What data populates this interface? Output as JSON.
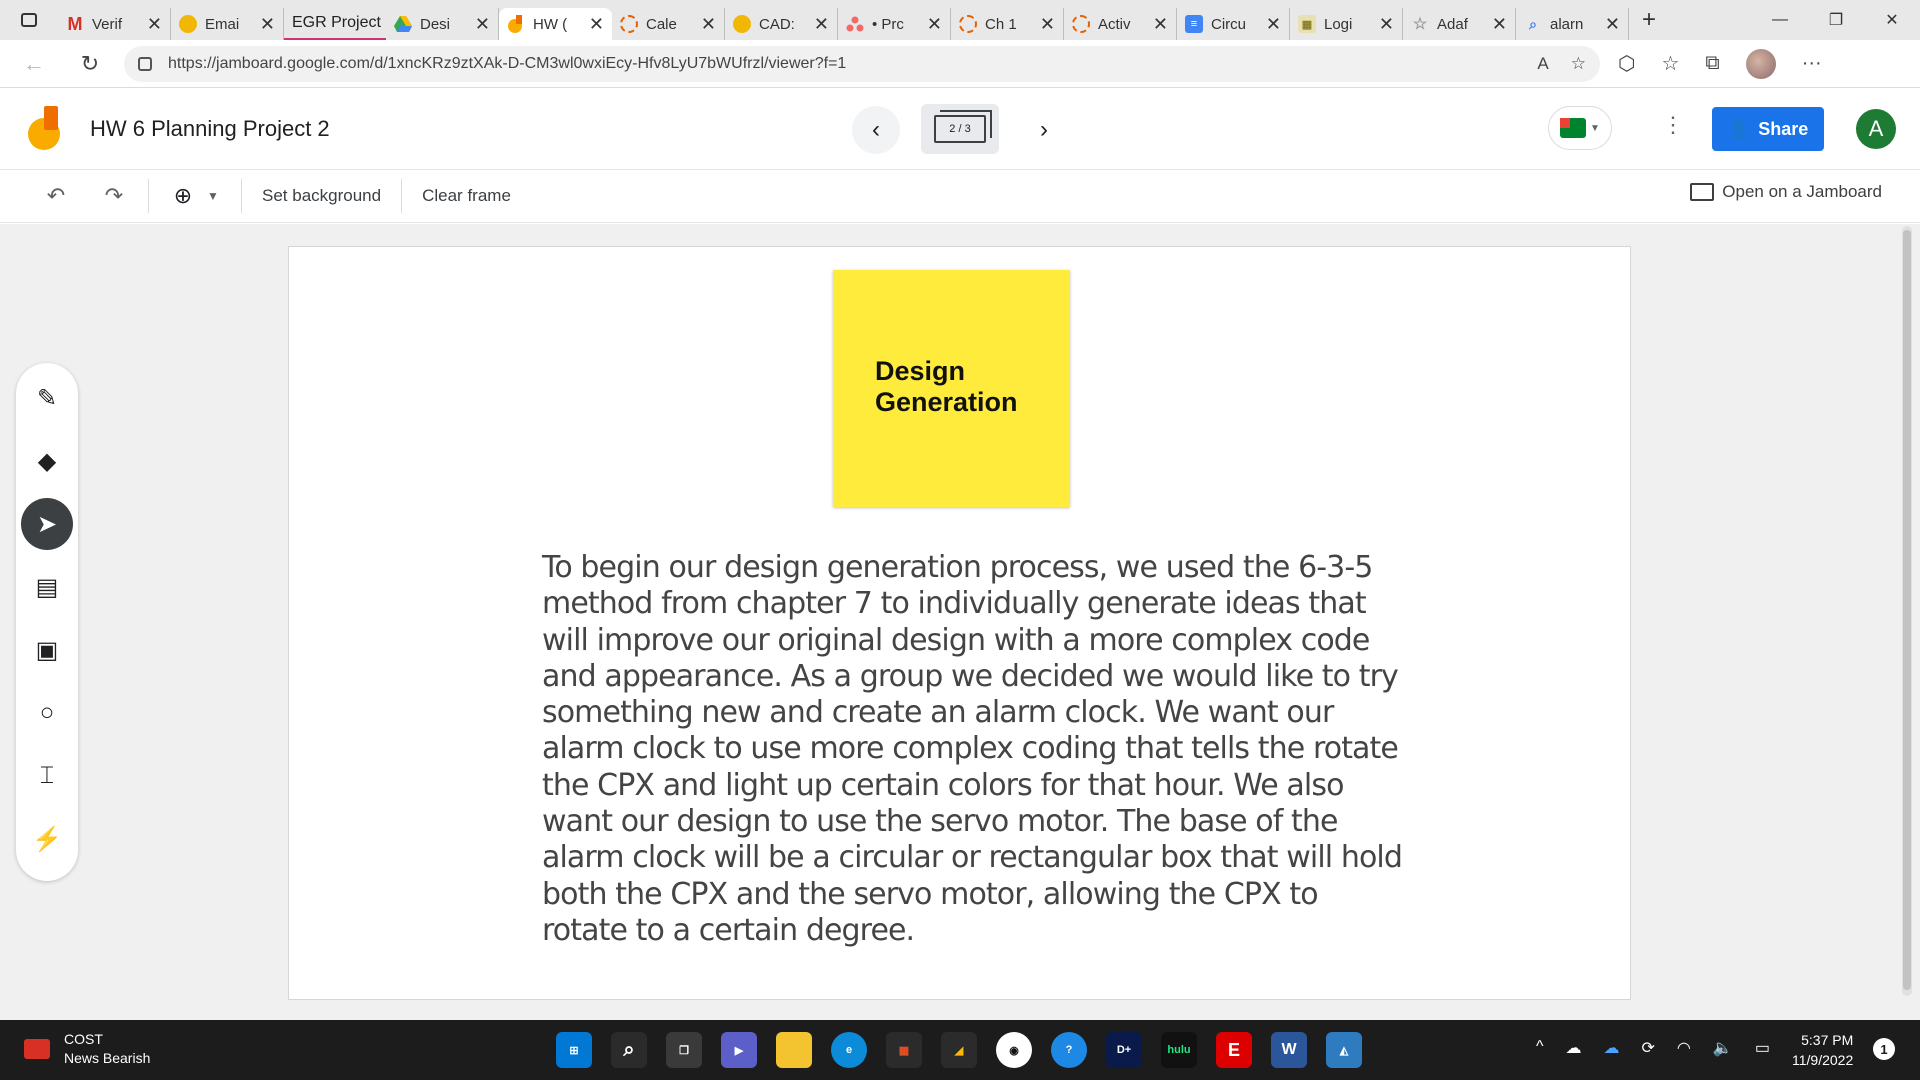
{
  "browser": {
    "tabs": [
      {
        "label": "Verif",
        "icon": "gmail-icon",
        "color": "#d93025",
        "glyph": "M"
      },
      {
        "label": "Emai",
        "icon": "avatar-icon",
        "color": "#f2b705",
        "glyph": ""
      },
      {
        "group": "EGR Project",
        "group_color": "#d0327a"
      },
      {
        "label": "Desi",
        "icon": "drive-icon",
        "color": "#34a853",
        "glyph": ""
      },
      {
        "label": "HW (",
        "icon": "jamboard-icon",
        "color": "#f9ab00",
        "glyph": "",
        "active": true
      },
      {
        "label": "Cale",
        "icon": "canvas-icon",
        "color": "#e66000",
        "glyph": ""
      },
      {
        "label": "CAD:",
        "icon": "avatar-icon",
        "color": "#f2b705",
        "glyph": ""
      },
      {
        "label": "• Prc",
        "icon": "asana-icon",
        "color": "#f06a6a",
        "glyph": ""
      },
      {
        "label": "Ch 1",
        "icon": "canvas-icon",
        "color": "#e66000",
        "glyph": ""
      },
      {
        "label": "Activ",
        "icon": "canvas-icon",
        "color": "#e66000",
        "glyph": ""
      },
      {
        "label": "Circu",
        "icon": "docs-icon",
        "color": "#4285f4",
        "glyph": ""
      },
      {
        "label": "Logi",
        "icon": "grid-icon",
        "color": "#c9b458",
        "glyph": ""
      },
      {
        "label": "Adaf",
        "icon": "star-icon",
        "color": "#9e9e9e",
        "glyph": ""
      },
      {
        "label": "alarn",
        "icon": "search-icon",
        "color": "#8ab4f8",
        "glyph": ""
      }
    ],
    "new_tab": "+",
    "url": "https://jamboard.google.com/d/1xncKRz9ztXAk-D-CM3wl0wxiEcy-Hfv8LyU7bWUfrzl/viewer?f=1"
  },
  "app": {
    "title": "HW 6 Planning Project 2",
    "frame_indicator": "2 / 3",
    "share_label": "Share",
    "avatar_letter": "A",
    "accent": "#1a73e8"
  },
  "toolbar": {
    "set_background": "Set background",
    "clear_frame": "Clear frame",
    "open_on_jamboard": "Open on a Jamboard"
  },
  "board": {
    "sticky_line1": "Design",
    "sticky_line2": "Generation",
    "sticky_color": "#ffeb3b",
    "text": "To begin our design generation process, we used the 6-3-5 method from chapter 7 to individually generate ideas that will improve our original design with a more complex code and appearance. As a group we decided we would like to try something new and create an alarm clock. We want our alarm clock to use more complex coding that tells the rotate the CPX and light up certain colors for that hour. We also want our design to use the servo motor. The base of the alarm clock will be a circular or rectangular box that will hold both the CPX and the servo motor, allowing the CPX to rotate to a certain degree."
  },
  "tools": [
    "pen-icon",
    "eraser-icon",
    "select-icon",
    "sticky-note-icon",
    "image-icon",
    "circle-icon",
    "text-box-icon",
    "laser-icon"
  ],
  "taskbar": {
    "weather_line1": "COST",
    "weather_line2": "News Bearish",
    "time": "5:37 PM",
    "date": "11/9/2022",
    "notification_count": "1"
  }
}
